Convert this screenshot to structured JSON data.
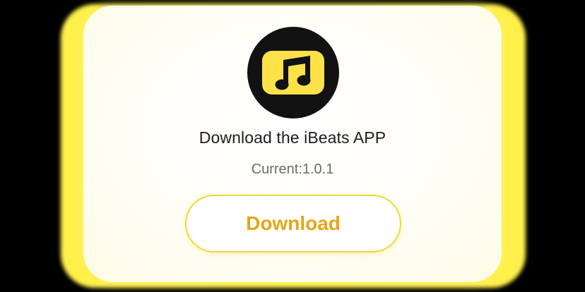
{
  "dialog": {
    "app_icon": "music-note-icon",
    "title": "Download the iBeats APP",
    "version": "Current:1.0.1",
    "download_label": "Download"
  },
  "colors": {
    "accent_yellow": "#ffe14a",
    "button_text": "#e6a516",
    "icon_background": "#121212"
  }
}
